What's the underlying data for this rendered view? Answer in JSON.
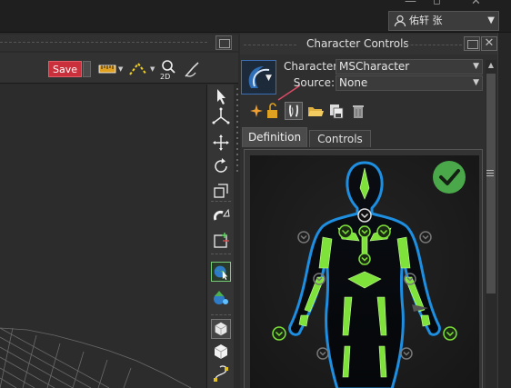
{
  "window": {
    "user_name": "佑轩 张",
    "user_dropdown_icon": "triangle-down-icon",
    "minimize_icon": "minimize-icon",
    "close_icon": "close-icon"
  },
  "toolbar": {
    "save_label": "Save",
    "icons": [
      "ruler-icon",
      "dashed-path-icon",
      "2d-zoom-icon",
      "brush-icon"
    ]
  },
  "tool_strip": {
    "icons": [
      "select-arrow-icon",
      "transform-axes-icon",
      "move-icon",
      "rotate-icon",
      "scale-icon",
      "magnet-snap-icon",
      "pivot-icon",
      "globe-select-icon",
      "node-link-icon",
      "cube-solid-icon",
      "cube-icon",
      "curve-icon"
    ]
  },
  "character_controls": {
    "title": "Character Controls",
    "character_label": "Character:",
    "character_value": "MSCharacter",
    "source_label": "Source:",
    "source_value": "None",
    "action_icons": [
      "star-sparkle-icon",
      "lock-open-icon",
      "bones-icon",
      "folder-open-icon",
      "save-stack-icon",
      "trash-icon"
    ],
    "tabs": [
      {
        "label": "Definition",
        "active": true
      },
      {
        "label": "Controls",
        "active": false
      }
    ],
    "status_icon": "checkmark-circle-icon",
    "colors": {
      "accent_green": "#7ee23b",
      "outline_blue": "#1e8fe0",
      "check_bg": "#4aa84a",
      "save_red": "#c9303c"
    }
  }
}
